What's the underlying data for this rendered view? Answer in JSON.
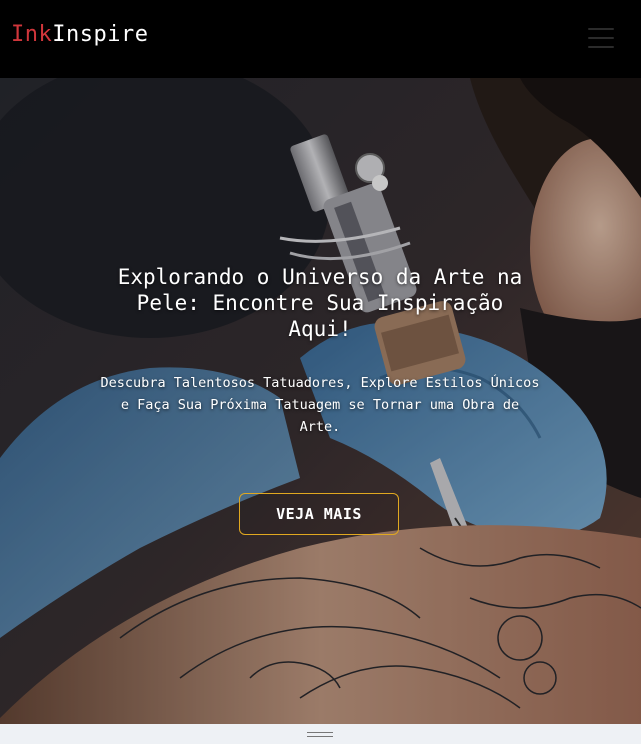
{
  "navbar": {
    "brand_part1": "Ink",
    "brand_part2": "Inspire",
    "menu_icon": "hamburger-menu-icon"
  },
  "hero": {
    "title": "Explorando o Universo da Arte na Pele: Encontre Sua Inspiração Aqui!",
    "subtitle": "Descubra Talentosos Tatuadores, Explore Estilos Únicos e Faça Sua Próxima Tatuagem se Tornar uma Obra de Arte.",
    "cta_label": "VEJA MAIS",
    "image": "tattoo-artist-working-photo"
  },
  "bottom_bar": {
    "icon": "resize-handle-icon"
  },
  "colors": {
    "brand_accent": "#d0363b",
    "cta_border": "#e0a820",
    "navbar_bg": "#000000"
  }
}
